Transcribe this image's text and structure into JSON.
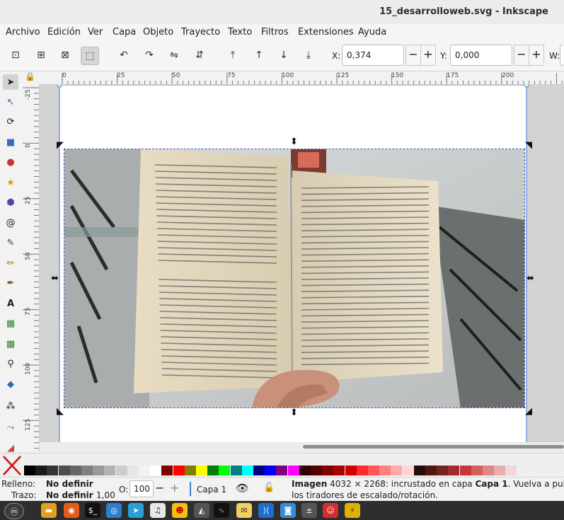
{
  "window": {
    "title": "15_desarrolloweb.svg - Inkscape"
  },
  "menu": [
    "Archivo",
    "Edición",
    "Ver",
    "Capa",
    "Objeto",
    "Trayecto",
    "Texto",
    "Filtros",
    "Extensiones",
    "Ayuda"
  ],
  "toolbar": {
    "x_label": "X:",
    "x_value": "0,374",
    "y_label": "Y:",
    "y_value": "0,000",
    "w_label": "W:",
    "minus": "−",
    "plus": "+"
  },
  "ruler_h": [
    "0",
    "25",
    "50",
    "75",
    "100",
    "125",
    "150",
    "175",
    "200"
  ],
  "ruler_v": [
    "-25",
    "0",
    "25",
    "50",
    "75",
    "100",
    "125"
  ],
  "status": {
    "fill_label": "Relleno:",
    "fill_value": "No definir",
    "stroke_label": "Trazo:",
    "stroke_value": "No definir",
    "stroke_width": "1,00",
    "opacity_label": "O:",
    "opacity_value": "100",
    "layer": "Capa 1",
    "message_bold": "Imagen",
    "message": " 4032 × 2268: incrustado en capa ",
    "message_layer": "Capa 1",
    "message_tail": ". Vuelva a pulsar en",
    "message_line2": "los tiradores de escalado/rotación."
  },
  "palette_colors": [
    "#000000",
    "#1a1a1a",
    "#333333",
    "#4d4d4d",
    "#666666",
    "#808080",
    "#999999",
    "#b3b3b3",
    "#cccccc",
    "#e6e6e6",
    "#f2f2f2",
    "#ffffff",
    "#800000",
    "#ff0000",
    "#808000",
    "#ffff00",
    "#008000",
    "#00ff00",
    "#008080",
    "#00ffff",
    "#000080",
    "#0000ff",
    "#800080",
    "#ff00ff",
    "#2b0000",
    "#550000",
    "#800000",
    "#aa0000",
    "#d40000",
    "#ff2a2a",
    "#ff5555",
    "#ff8080",
    "#ffaaaa",
    "#ffd5d5",
    "#280b0b",
    "#501616",
    "#782121",
    "#a02c2c",
    "#c83737",
    "#d35f5f",
    "#de8787",
    "#e9afaf",
    "#f4d7d7"
  ]
}
